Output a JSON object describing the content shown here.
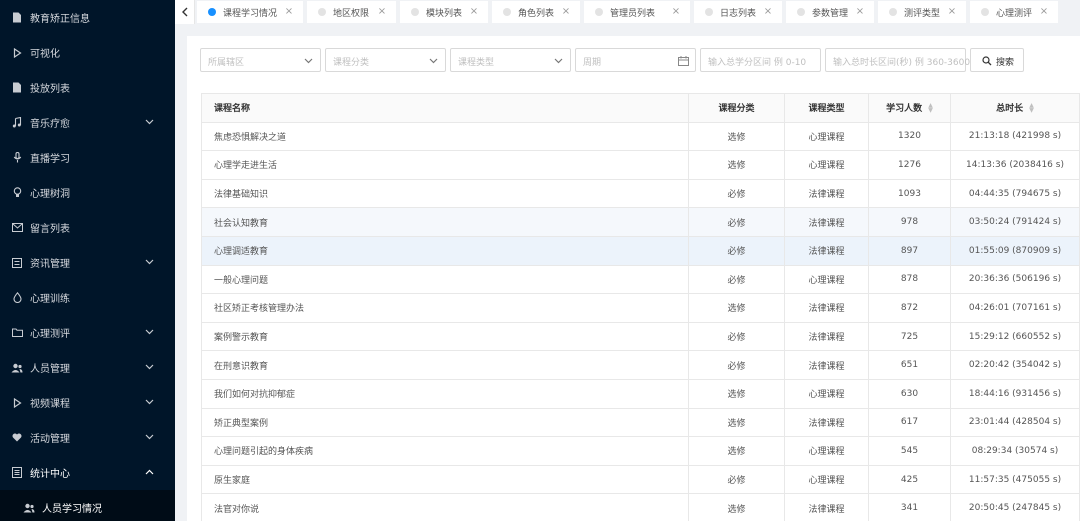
{
  "sidebar": {
    "items": [
      {
        "label": "教育矫正信息",
        "icon": "document-icon",
        "arrow": false
      },
      {
        "label": "可视化",
        "icon": "play-icon",
        "arrow": false
      },
      {
        "label": "投放列表",
        "icon": "document-icon",
        "arrow": false
      },
      {
        "label": "音乐疗愈",
        "icon": "music-icon",
        "arrow": true
      },
      {
        "label": "直播学习",
        "icon": "microphone-icon",
        "arrow": false
      },
      {
        "label": "心理树洞",
        "icon": "bulb-icon",
        "arrow": false
      },
      {
        "label": "留言列表",
        "icon": "message-icon",
        "arrow": false
      },
      {
        "label": "资讯管理",
        "icon": "news-icon",
        "arrow": true
      },
      {
        "label": "心理训练",
        "icon": "drop-icon",
        "arrow": false
      },
      {
        "label": "心理测评",
        "icon": "folder-icon",
        "arrow": true
      },
      {
        "label": "人员管理",
        "icon": "users-icon",
        "arrow": true
      },
      {
        "label": "视频课程",
        "icon": "play-icon",
        "arrow": true
      },
      {
        "label": "活动管理",
        "icon": "heart-icon",
        "arrow": true
      },
      {
        "label": "统计中心",
        "icon": "stats-icon",
        "arrow": true,
        "expanded": true
      }
    ],
    "sub_items": [
      {
        "label": "人员学习情况",
        "icon": "users-icon"
      }
    ]
  },
  "tabs": [
    {
      "label": "课程学习情况",
      "active": true
    },
    {
      "label": "地区权限",
      "active": false
    },
    {
      "label": "模块列表",
      "active": false
    },
    {
      "label": "角色列表",
      "active": false
    },
    {
      "label": "管理员列表",
      "active": false
    },
    {
      "label": "日志列表",
      "active": false
    },
    {
      "label": "参数管理",
      "active": false
    },
    {
      "label": "测评类型",
      "active": false
    },
    {
      "label": "心理测评",
      "active": false
    }
  ],
  "tab_close_glyph": "×",
  "filters": {
    "region_placeholder": "所属辖区",
    "category_placeholder": "课程分类",
    "type_placeholder": "课程类型",
    "period_placeholder": "周期",
    "score_placeholder": "输入总学分区间 例 0-10",
    "duration_placeholder": "输入总时长区间(秒) 例 360-3600",
    "search_label": "搜索"
  },
  "table": {
    "headers": {
      "name": "课程名称",
      "category": "课程分类",
      "type": "课程类型",
      "count": "学习人数",
      "duration": "总时长"
    },
    "rows": [
      {
        "name": "焦虑恐惧解决之道",
        "category": "选修",
        "type": "心理课程",
        "count": "1320",
        "duration": "21:13:18 (421998 s)"
      },
      {
        "name": "心理学走进生活",
        "category": "选修",
        "type": "心理课程",
        "count": "1276",
        "duration": "14:13:36 (2038416 s)"
      },
      {
        "name": "法律基础知识",
        "category": "必修",
        "type": "法律课程",
        "count": "1093",
        "duration": "04:44:35 (794675 s)"
      },
      {
        "name": "社会认知教育",
        "category": "必修",
        "type": "法律课程",
        "count": "978",
        "duration": "03:50:24 (791424 s)"
      },
      {
        "name": "心理调适教育",
        "category": "必修",
        "type": "法律课程",
        "count": "897",
        "duration": "01:55:09 (870909 s)"
      },
      {
        "name": "一般心理问题",
        "category": "必修",
        "type": "心理课程",
        "count": "878",
        "duration": "20:36:36 (506196 s)"
      },
      {
        "name": "社区矫正考核管理办法",
        "category": "选修",
        "type": "法律课程",
        "count": "872",
        "duration": "04:26:01 (707161 s)"
      },
      {
        "name": "案例警示教育",
        "category": "必修",
        "type": "法律课程",
        "count": "725",
        "duration": "15:29:12 (660552 s)"
      },
      {
        "name": "在刑意识教育",
        "category": "必修",
        "type": "法律课程",
        "count": "651",
        "duration": "02:20:42 (354042 s)"
      },
      {
        "name": "我们如何对抗抑郁症",
        "category": "选修",
        "type": "心理课程",
        "count": "630",
        "duration": "18:44:16 (931456 s)"
      },
      {
        "name": "矫正典型案例",
        "category": "选修",
        "type": "法律课程",
        "count": "617",
        "duration": "23:01:44 (428504 s)"
      },
      {
        "name": "心理问题引起的身体疾病",
        "category": "选修",
        "type": "心理课程",
        "count": "545",
        "duration": "08:29:34 (30574 s)"
      },
      {
        "name": "原生家庭",
        "category": "必修",
        "type": "心理课程",
        "count": "425",
        "duration": "11:57:35 (475055 s)"
      },
      {
        "name": "法官对你说",
        "category": "选修",
        "type": "法律课程",
        "count": "341",
        "duration": "20:50:45 (247845 s)"
      }
    ]
  }
}
